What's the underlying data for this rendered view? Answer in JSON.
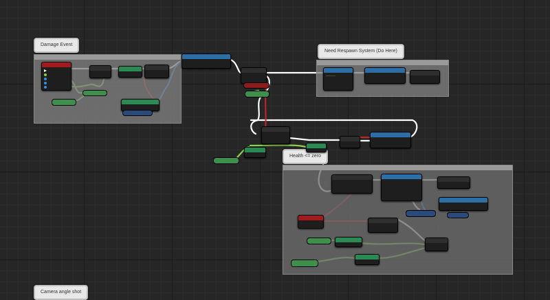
{
  "comments": {
    "damage_event": "Damage Event",
    "respawn_system": "Need Respawn System (Do Here)",
    "health_zero": "Health <= zero",
    "camera_angle": "Camera angle shot"
  },
  "colors": {
    "exec_wire": "#ffffff",
    "float_wire": "#8bd14a",
    "object_wire": "#3a8de0",
    "bool_wire": "#c9232a",
    "node_header_blue": "#2b6fa6",
    "node_header_red": "#a31a1a",
    "comment_bubble": "#e8e8e8"
  }
}
